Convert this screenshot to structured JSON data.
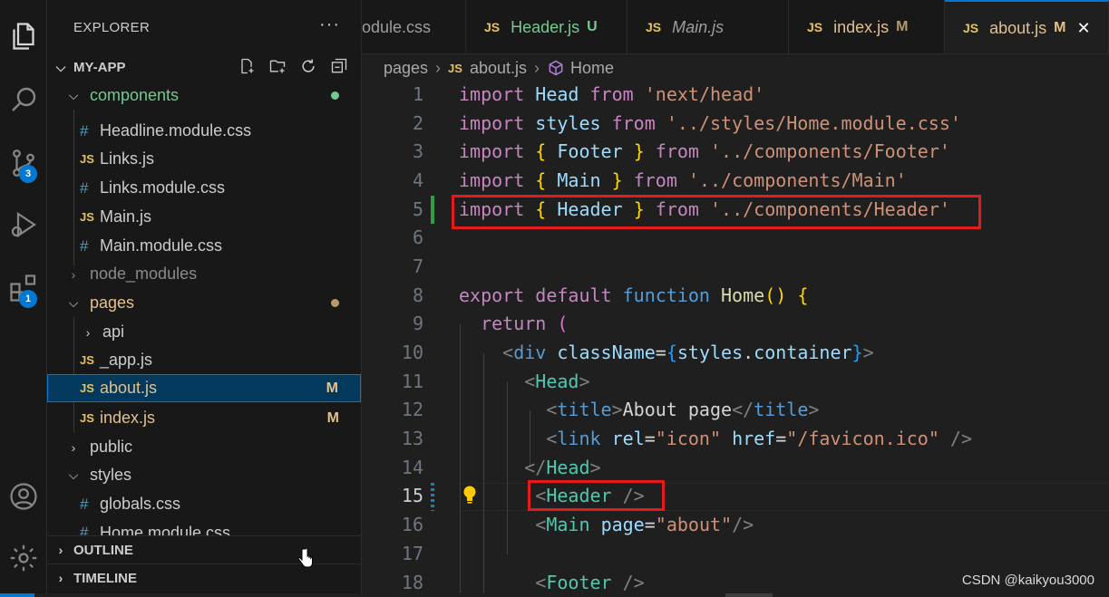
{
  "activity": {
    "source_control_badge": "3",
    "extensions_badge": "1"
  },
  "sidebar": {
    "title": "EXPLORER",
    "more": "···",
    "project": "MY-APP",
    "tree": [
      {
        "label": "components",
        "kind": "folder-open"
      },
      {
        "label": "Headline.module.css",
        "kind": "css"
      },
      {
        "label": "Links.js",
        "kind": "js"
      },
      {
        "label": "Links.module.css",
        "kind": "css"
      },
      {
        "label": "Main.js",
        "kind": "js"
      },
      {
        "label": "Main.module.css",
        "kind": "css"
      },
      {
        "label": "node_modules",
        "kind": "folder-closed"
      },
      {
        "label": "pages",
        "kind": "folder-open"
      },
      {
        "label": "api",
        "kind": "folder-closed"
      },
      {
        "label": "_app.js",
        "kind": "js"
      },
      {
        "label": "about.js",
        "kind": "js",
        "status": "M"
      },
      {
        "label": "index.js",
        "kind": "js",
        "status": "M"
      },
      {
        "label": "public",
        "kind": "folder-closed"
      },
      {
        "label": "styles",
        "kind": "folder-open"
      },
      {
        "label": "globals.css",
        "kind": "css"
      },
      {
        "label": "Home.module.css",
        "kind": "css"
      }
    ],
    "outline": "OUTLINE",
    "timeline": "TIMELINE"
  },
  "tabs": [
    {
      "label": "odule.css",
      "icon": "#",
      "status": ""
    },
    {
      "label": "Header.js",
      "icon": "JS",
      "status": "U"
    },
    {
      "label": "Main.js",
      "icon": "JS",
      "status": ""
    },
    {
      "label": "index.js",
      "icon": "JS",
      "status": "M"
    },
    {
      "label": "about.js",
      "icon": "JS",
      "status": "M",
      "close": "✕"
    }
  ],
  "breadcrumb": {
    "folder": "pages",
    "file_icon": "JS",
    "file": "about.js",
    "symbol": "Home"
  },
  "editor": {
    "line_numbers": [
      "1",
      "2",
      "3",
      "4",
      "5",
      "6",
      "7",
      "8",
      "9",
      "10",
      "11",
      "12",
      "13",
      "14",
      "15",
      "16",
      "17",
      "18"
    ],
    "current_line": "15"
  },
  "watermark": "CSDN @kaikyou3000",
  "colors": {
    "accent": "#0078d4",
    "highlight_box": "#e51a1a",
    "git_added": "#2ea043"
  }
}
